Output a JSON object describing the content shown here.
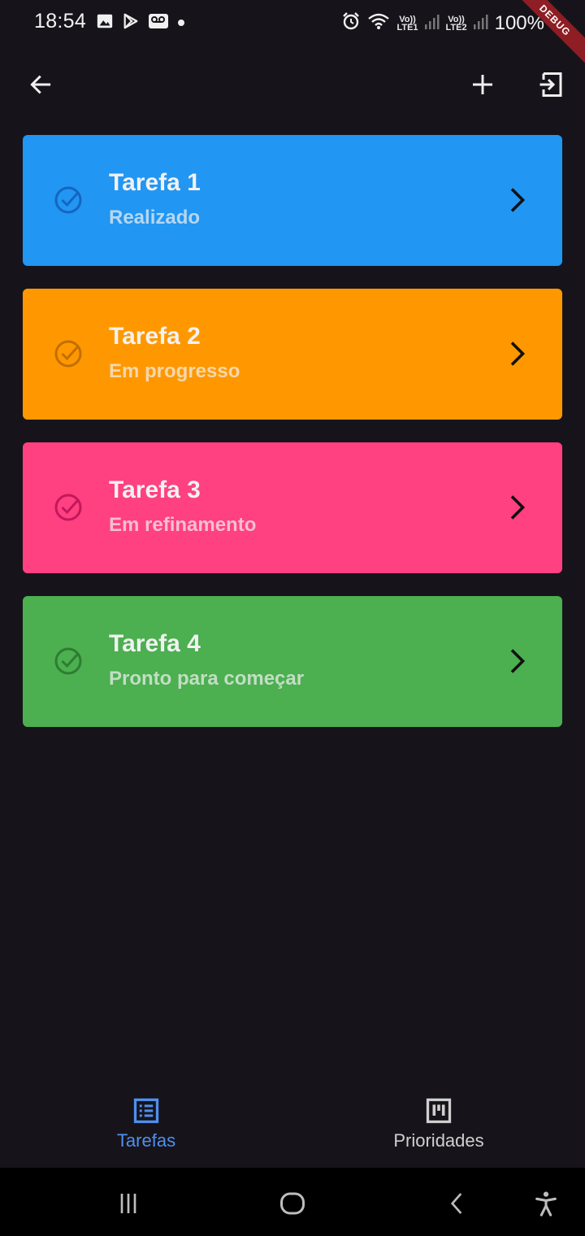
{
  "status_bar": {
    "time": "18:54",
    "sim1": "LTE1",
    "sim2": "LTE2",
    "volte": "Vo))",
    "battery": "100%",
    "debug_banner": "DEBUG"
  },
  "app_bar": {
    "back_icon": "arrow-left-icon",
    "add_icon": "plus-icon",
    "logout_icon": "logout-icon"
  },
  "tasks": [
    {
      "title": "Tarefa 1",
      "status": "Realizado",
      "color": "#2196f3",
      "check_color": "#1565c0"
    },
    {
      "title": "Tarefa 2",
      "status": "Em progresso",
      "color": "#ff9800",
      "check_color": "#c26e00"
    },
    {
      "title": "Tarefa 3",
      "status": "Em refinamento",
      "color": "#ff4081",
      "check_color": "#c2185b"
    },
    {
      "title": "Tarefa 4",
      "status": "Pronto para começar",
      "color": "#4caf50",
      "check_color": "#2e7d32"
    }
  ],
  "bottom_nav": {
    "items": [
      {
        "label": "Tarefas",
        "icon": "list-icon",
        "active": true
      },
      {
        "label": "Prioridades",
        "icon": "board-icon",
        "active": false
      }
    ],
    "active_color": "#4f8ff0",
    "inactive_color": "#cfcfcf"
  },
  "system_nav": {
    "recents_icon": "recents-icon",
    "home_icon": "home-icon",
    "back_icon": "back-icon",
    "accessibility_icon": "accessibility-icon"
  }
}
